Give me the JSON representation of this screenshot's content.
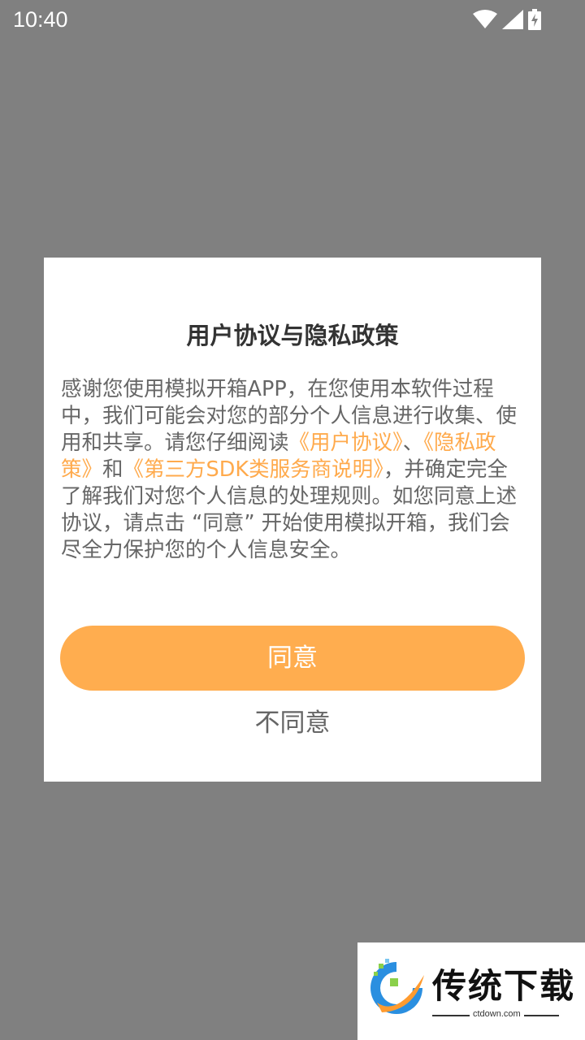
{
  "status_bar": {
    "time": "10:40",
    "icons": [
      "wifi-icon",
      "signal-icon",
      "battery-charging-icon"
    ]
  },
  "dialog": {
    "title": "用户协议与隐私政策",
    "body_segments": [
      {
        "text": "感谢您使用模拟开箱APP，在您使用本软件过程中，我们可能会对您的部分个人信息进行收集、使用和共享。请您仔细阅读",
        "link": false
      },
      {
        "text": "《用户协议》",
        "link": true
      },
      {
        "text": "、",
        "link": false
      },
      {
        "text": "《隐私政策》",
        "link": true
      },
      {
        "text": "和",
        "link": false
      },
      {
        "text": "《第三方SDK类服务商说明》",
        "link": true
      },
      {
        "text": "，并确定完全了解我们对您个人信息的处理规则。如您同意上述协议，请点击 “同意” 开始使用模拟开箱，我们会尽全力保护您的个人信息安全。",
        "link": false
      }
    ],
    "agree_label": "同意",
    "disagree_label": "不同意"
  },
  "watermark": {
    "title": "传统下载",
    "subtitle": "ctdown.com"
  },
  "colors": {
    "overlay": "#808080",
    "accent": "#ffad4f",
    "link": "#ffaa4c"
  }
}
